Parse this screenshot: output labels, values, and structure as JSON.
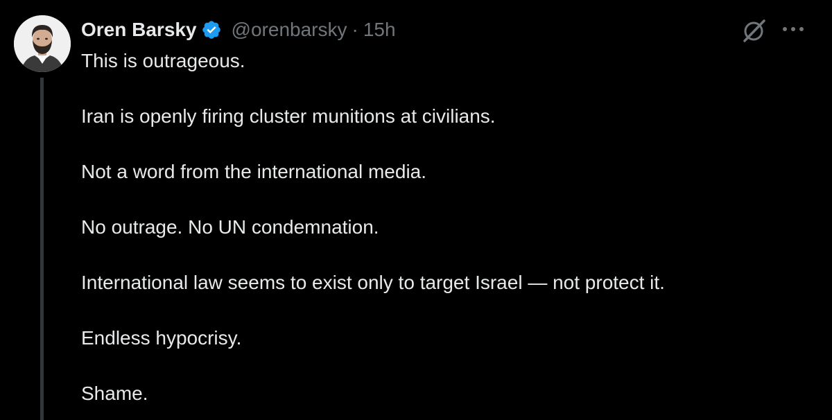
{
  "tweet": {
    "author": {
      "display_name": "Oren Barsky",
      "handle": "@orenbarsky",
      "verified": true
    },
    "separator": "·",
    "timestamp": "15h",
    "paragraphs": [
      "This is outrageous.",
      "Iran is openly firing cluster munitions at civilians.",
      "Not a word from the international media.",
      "No outrage. No UN condemnation.",
      "International law seems to exist only to target Israel — not protect it.",
      "Endless hypocrisy.",
      "Shame."
    ]
  },
  "icons": {
    "avatar": "avatar",
    "verified": "verified-badge-icon",
    "grok": "grok-icon",
    "more": "more-options-icon"
  },
  "colors": {
    "background": "#000000",
    "text_primary": "#e7e9ea",
    "text_secondary": "#71767b",
    "verified_blue": "#1d9bf0",
    "thread_line": "#333639"
  }
}
